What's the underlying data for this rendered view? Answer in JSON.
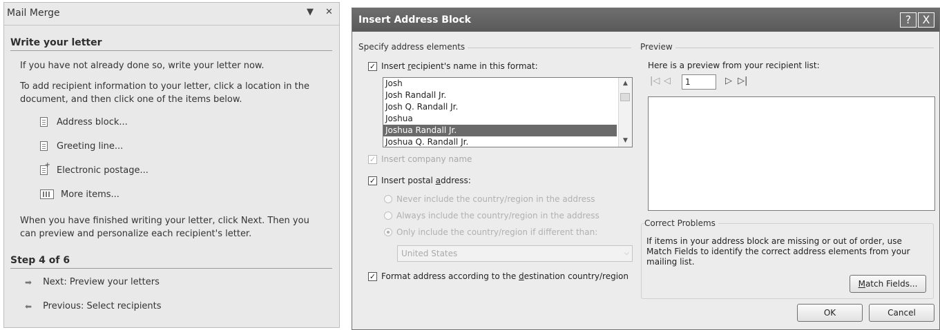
{
  "task_pane": {
    "title": "Mail Merge",
    "section1_heading": "Write your letter",
    "para1": "If you have not already done so, write your letter now.",
    "para2": "To add recipient information to your letter, click a location in the document, and then click one of the items below.",
    "items": [
      {
        "label": "Address block...",
        "icon": "document-icon"
      },
      {
        "label": "Greeting line...",
        "icon": "document-icon"
      },
      {
        "label": "Electronic postage...",
        "icon": "postage-icon"
      },
      {
        "label": "More items...",
        "icon": "more-items-icon"
      }
    ],
    "para3": "When you have finished writing your letter, click Next. Then you can preview and personalize each recipient's letter.",
    "step_heading": "Step 4 of 6",
    "next_label": "Next: Preview your letters",
    "prev_label": "Previous: Select recipients"
  },
  "dialog": {
    "title": "Insert Address Block",
    "help_glyph": "?",
    "close_glyph": "X",
    "specify_label": "Specify address elements",
    "name_format_label": "Insert recipient's name in this format:",
    "name_format_pre": "Insert ",
    "name_format_acc": "r",
    "name_format_post": "ecipient's name in this format:",
    "name_options": [
      "Josh",
      "Josh Randall Jr.",
      "Josh Q. Randall Jr.",
      "Joshua",
      "Joshua Randall Jr.",
      "Joshua Q. Randall Jr."
    ],
    "name_selected_index": 4,
    "company_label": "Insert company name",
    "postal_pre": "Insert postal ",
    "postal_acc": "a",
    "postal_post": "ddress:",
    "radio_never": "Never include the country/region in the address",
    "radio_always": "Always include the country/region in the address",
    "radio_only": "Only include the country/region if different than:",
    "country_value": "United States",
    "format_pre": "Format address according to the ",
    "format_acc": "d",
    "format_post": "estination country/region",
    "preview_label": "Preview",
    "preview_sub": "Here is a preview from your recipient list:",
    "record_number": "1",
    "correct_label": "Correct Problems",
    "correct_text": "If items in your address block are missing or out of order, use Match Fields to identify the correct address elements from your mailing list.",
    "match_pre": "",
    "match_acc": "M",
    "match_post": "atch Fields...",
    "ok_label": "OK",
    "cancel_label": "Cancel"
  },
  "colors": {
    "titlebar": "#5f5f5f",
    "selection": "#6a6a6a",
    "pane_bg": "#e9e9e9",
    "dialog_bg": "#ececec"
  }
}
